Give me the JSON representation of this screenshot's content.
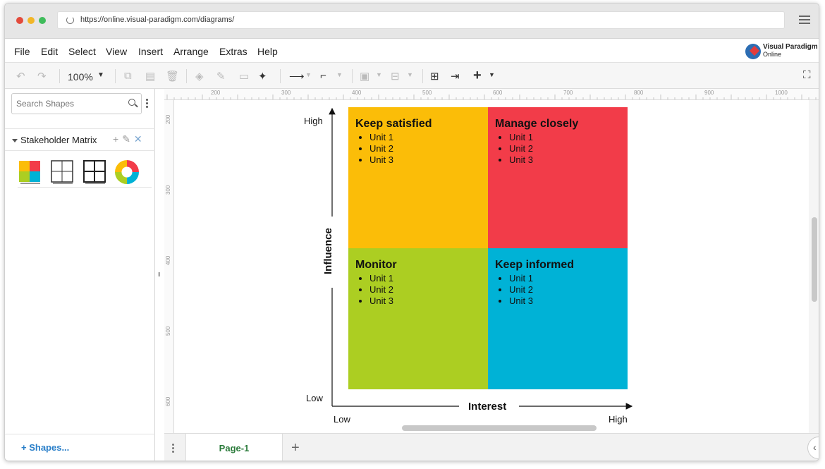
{
  "browser": {
    "url": "https://online.visual-paradigm.com/diagrams/"
  },
  "menu": [
    "File",
    "Edit",
    "Select",
    "View",
    "Insert",
    "Arrange",
    "Extras",
    "Help"
  ],
  "logo": {
    "line1": "Visual Paradigm",
    "line2": "Online"
  },
  "toolbar": {
    "zoom": "100%"
  },
  "sidebar": {
    "search_placeholder": "Search Shapes",
    "section_title": "Stakeholder Matrix",
    "shapes_link": "+ Shapes..."
  },
  "rulers": {
    "top": [
      "200",
      "300",
      "400",
      "500",
      "600",
      "700",
      "800",
      "900",
      "1000"
    ],
    "left": [
      "200",
      "300",
      "400",
      "500",
      "600"
    ]
  },
  "diagram": {
    "y_axis_title": "Influence",
    "x_axis_title": "Interest",
    "y_high": "High",
    "y_low": "Low",
    "x_low": "Low",
    "x_high": "High",
    "quadrants": [
      {
        "title": "Keep satisfied",
        "items": [
          "Unit 1",
          "Unit 2",
          "Unit 3"
        ],
        "color": "#fbbd08"
      },
      {
        "title": "Manage closely",
        "items": [
          "Unit 1",
          "Unit 2",
          "Unit 3"
        ],
        "color": "#f23c49"
      },
      {
        "title": "Monitor",
        "items": [
          "Unit 1",
          "Unit 2",
          "Unit 3"
        ],
        "color": "#acce22"
      },
      {
        "title": "Keep informed",
        "items": [
          "Unit 1",
          "Unit 2",
          "Unit 3"
        ],
        "color": "#00b2d6"
      }
    ]
  },
  "pages": {
    "current": "Page-1"
  }
}
